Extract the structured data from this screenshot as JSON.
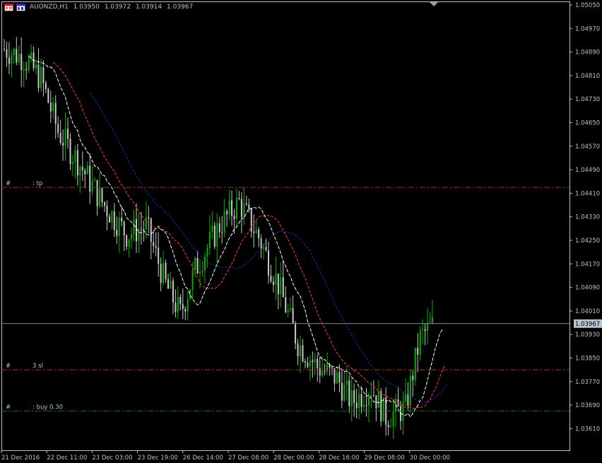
{
  "header": {
    "symbol": "AUDNZD,H1",
    "open": "1.03950",
    "high": "1.03972",
    "low": "1.03914",
    "close": "1.03967"
  },
  "colors": {
    "background": "#000000",
    "bull": "#00b000",
    "bear": "#c8c8c8",
    "ma_fast": "#ffffff",
    "ma_mid": "#ff3a3a",
    "ma_slow": "#1e2fb0",
    "tp_line": "#b03030",
    "sl_line": "#b03030",
    "entry_line": "#008000",
    "price_line": "#8a8a9a",
    "axis": "#c0c0c0",
    "current_price_bg": "#b8c4d0"
  },
  "icons": [
    "app-window-icon",
    "chart-window-icon",
    "scroll-marker-icon"
  ],
  "price_axis": {
    "labels": [
      "1.05050",
      "1.04970",
      "1.04890",
      "1.04810",
      "1.04730",
      "1.04650",
      "1.04570",
      "1.04490",
      "1.04410",
      "1.04330",
      "1.04250",
      "1.04170",
      "1.04090",
      "1.04010",
      "1.03930",
      "1.03850",
      "1.03770",
      "1.03690",
      "1.03610"
    ],
    "current_price": "1.03967"
  },
  "time_axis": {
    "labels": [
      "21 Dec 2016",
      "22 Dec 11:00",
      "23 Dec 03:00",
      "23 Dec 19:00",
      "26 Dec 14:00",
      "27 Dec 08:00",
      "28 Dec 00:00",
      "28 Dec 16:00",
      "29 Dec 08:00",
      "30 Dec 00:00"
    ]
  },
  "order_lines": [
    {
      "id": "tp",
      "prefix": "#",
      "label": ": tp",
      "price": 1.0443
    },
    {
      "id": "sl",
      "prefix": "#",
      "label": "3 sl",
      "price": 1.0381
    },
    {
      "id": "entry",
      "prefix": "#",
      "label": ": buy 0.30",
      "price": 1.0367
    }
  ],
  "chart_data": {
    "type": "candlestick",
    "symbol": "AUDNZD",
    "timeframe": "H1",
    "ylim": [
      1.0359,
      1.0507
    ],
    "current_price": 1.03967,
    "price_anchors": [
      {
        "bar": 0,
        "price": 1.049
      },
      {
        "bar": 8,
        "price": 1.0487
      },
      {
        "bar": 15,
        "price": 1.048
      },
      {
        "bar": 22,
        "price": 1.0462
      },
      {
        "bar": 30,
        "price": 1.0452
      },
      {
        "bar": 40,
        "price": 1.0438
      },
      {
        "bar": 50,
        "price": 1.0427
      },
      {
        "bar": 58,
        "price": 1.043
      },
      {
        "bar": 66,
        "price": 1.041
      },
      {
        "bar": 72,
        "price": 1.04
      },
      {
        "bar": 78,
        "price": 1.0415
      },
      {
        "bar": 88,
        "price": 1.043
      },
      {
        "bar": 96,
        "price": 1.0438
      },
      {
        "bar": 104,
        "price": 1.0426
      },
      {
        "bar": 112,
        "price": 1.041
      },
      {
        "bar": 120,
        "price": 1.039
      },
      {
        "bar": 128,
        "price": 1.0382
      },
      {
        "bar": 136,
        "price": 1.0378
      },
      {
        "bar": 142,
        "price": 1.037
      },
      {
        "bar": 150,
        "price": 1.0375
      },
      {
        "bar": 156,
        "price": 1.0365
      },
      {
        "bar": 164,
        "price": 1.0368
      },
      {
        "bar": 170,
        "price": 1.0392
      },
      {
        "bar": 175,
        "price": 1.0396
      }
    ],
    "series": [
      "close",
      "ma_fast",
      "ma_mid",
      "ma_slow"
    ]
  }
}
